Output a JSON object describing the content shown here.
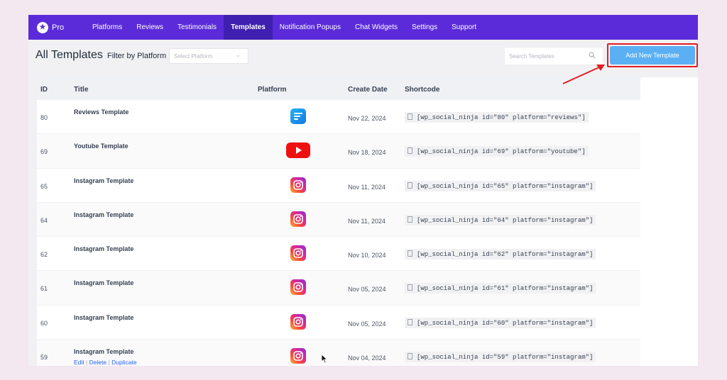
{
  "brand": {
    "logo_glyph": "★",
    "name": "Pro"
  },
  "nav": [
    {
      "label": "Platforms",
      "active": false
    },
    {
      "label": "Reviews",
      "active": false
    },
    {
      "label": "Testimonials",
      "active": false
    },
    {
      "label": "Templates",
      "active": true
    },
    {
      "label": "Notification Popups",
      "active": false
    },
    {
      "label": "Chat Widgets",
      "active": false
    },
    {
      "label": "Settings",
      "active": false
    },
    {
      "label": "Support",
      "active": false
    }
  ],
  "toolbar": {
    "title": "All Templates",
    "filter_label": "Filter by Platform",
    "select_placeholder": "Select Platform",
    "search_placeholder": "Search Templates",
    "add_button": "Add New Template"
  },
  "table": {
    "headers": {
      "id": "ID",
      "title": "Title",
      "platform": "Platform",
      "date": "Create Date",
      "shortcode": "Shortcode"
    },
    "rows": [
      {
        "id": "80",
        "title": "Reviews Template",
        "platform": "reviews",
        "date": "Nov 22, 2024",
        "shortcode": "[wp_social_ninja id=\"80\" platform=\"reviews\"]"
      },
      {
        "id": "69",
        "title": "Youtube Template",
        "platform": "youtube",
        "date": "Nov 18, 2024",
        "shortcode": "[wp_social_ninja id=\"69\" platform=\"youtube\"]"
      },
      {
        "id": "65",
        "title": "Instagram Template",
        "platform": "instagram",
        "date": "Nov 11, 2024",
        "shortcode": "[wp_social_ninja id=\"65\" platform=\"instagram\"]"
      },
      {
        "id": "64",
        "title": "Instagram Template",
        "platform": "instagram",
        "date": "Nov 11, 2024",
        "shortcode": "[wp_social_ninja id=\"64\" platform=\"instagram\"]"
      },
      {
        "id": "62",
        "title": "Instagram Template",
        "platform": "instagram",
        "date": "Nov 10, 2024",
        "shortcode": "[wp_social_ninja id=\"62\" platform=\"instagram\"]"
      },
      {
        "id": "61",
        "title": "Instagram Template",
        "platform": "instagram",
        "date": "Nov 05, 2024",
        "shortcode": "[wp_social_ninja id=\"61\" platform=\"instagram\"]"
      },
      {
        "id": "60",
        "title": "Instagram Template",
        "platform": "instagram",
        "date": "Nov 05, 2024",
        "shortcode": "[wp_social_ninja id=\"60\" platform=\"instagram\"]"
      },
      {
        "id": "59",
        "title": "Instagram Template",
        "platform": "instagram",
        "date": "Nov 04, 2024",
        "shortcode": "[wp_social_ninja id=\"59\" platform=\"instagram\"]",
        "actions": [
          "Edit",
          "Delete",
          "Duplicate"
        ]
      }
    ]
  },
  "colors": {
    "nav_bg": "#5b2bd9",
    "nav_active": "#3f1fb0",
    "add_button": "#5ab0f2",
    "highlight": "#e31d23",
    "link": "#2563eb"
  }
}
